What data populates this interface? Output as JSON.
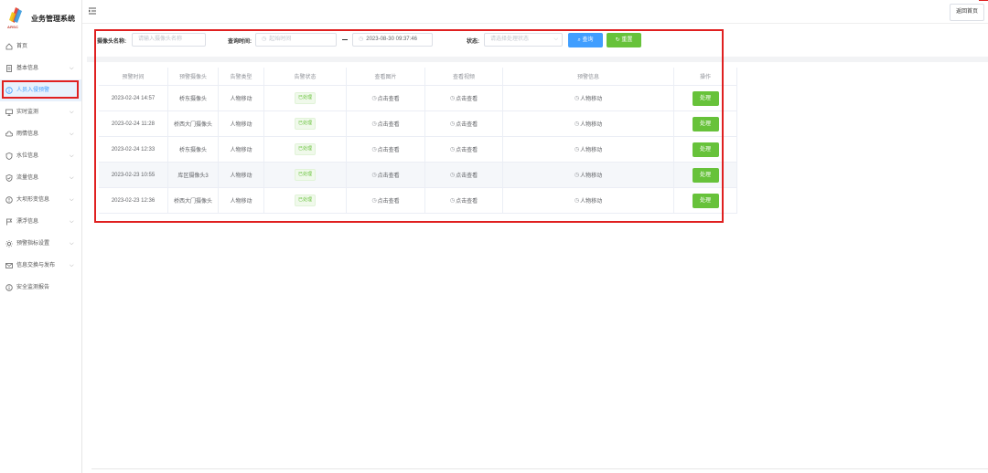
{
  "app": {
    "title": "业务管理系统",
    "logo_text": "ARSC"
  },
  "sidebar": {
    "items": [
      {
        "label": "首页",
        "icon": "home-icon",
        "has_children": false
      },
      {
        "label": "基本信息",
        "icon": "document-icon",
        "has_children": true
      },
      {
        "label": "人员入侵预警",
        "icon": "info-circle-icon",
        "has_children": false,
        "active": true
      },
      {
        "label": "实时监测",
        "icon": "monitor-icon",
        "has_children": true
      },
      {
        "label": "雨情信息",
        "icon": "cloud-icon",
        "has_children": true
      },
      {
        "label": "水位信息",
        "icon": "shield-icon",
        "has_children": true
      },
      {
        "label": "流量信息",
        "icon": "shield-check-icon",
        "has_children": true
      },
      {
        "label": "大坝形变信息",
        "icon": "alert-circle-icon",
        "has_children": true
      },
      {
        "label": "漂浮信息",
        "icon": "flag-icon",
        "has_children": true
      },
      {
        "label": "预警指标设置",
        "icon": "sun-icon",
        "has_children": true
      },
      {
        "label": "信息交换与发布",
        "icon": "mail-icon",
        "has_children": true
      },
      {
        "label": "安全监测报告",
        "icon": "info-circle-icon",
        "has_children": false
      }
    ]
  },
  "topbar": {
    "back_label": "返回首页"
  },
  "filters": {
    "camera_label": "摄像头名称:",
    "camera_placeholder": "请输入摄像头名称",
    "time_label": "查询时间:",
    "start_placeholder": "起始时间",
    "end_value": "2023-08-30 09:37:46",
    "status_label": "状态:",
    "status_placeholder": "请选择处理状态",
    "search_label": "查询",
    "reset_label": "重置"
  },
  "table": {
    "columns": [
      "预警时间",
      "预警摄像头",
      "告警类型",
      "告警状态",
      "查看图片",
      "查看视频",
      "预警信息",
      "操作"
    ],
    "rows": [
      {
        "time": "2023-02-24 14:57",
        "camera": "桥东摄像头",
        "type": "人物移动",
        "status": "已处理",
        "image": "点击查看",
        "video": "点击查看",
        "info": "人物移动",
        "action": "处理"
      },
      {
        "time": "2023-02-24 11:28",
        "camera": "桥西大门摄像头",
        "type": "人物移动",
        "status": "已处理",
        "image": "点击查看",
        "video": "点击查看",
        "info": "人物移动",
        "action": "处理"
      },
      {
        "time": "2023-02-24 12:33",
        "camera": "桥东摄像头",
        "type": "人物移动",
        "status": "已处理",
        "image": "点击查看",
        "video": "点击查看",
        "info": "人物移动",
        "action": "处理"
      },
      {
        "time": "2023-02-23 10:55",
        "camera": "库区摄像头3",
        "type": "人物移动",
        "status": "已处理",
        "image": "点击查看",
        "video": "点击查看",
        "info": "人物移动",
        "action": "处理"
      },
      {
        "time": "2023-02-23 12:36",
        "camera": "桥西大门摄像头",
        "type": "人物移动",
        "status": "已处理",
        "image": "点击查看",
        "video": "点击查看",
        "info": "人物移动",
        "action": "处理"
      }
    ]
  },
  "colors": {
    "primary": "#409eff",
    "success": "#67c23a",
    "highlight": "#e02020"
  }
}
